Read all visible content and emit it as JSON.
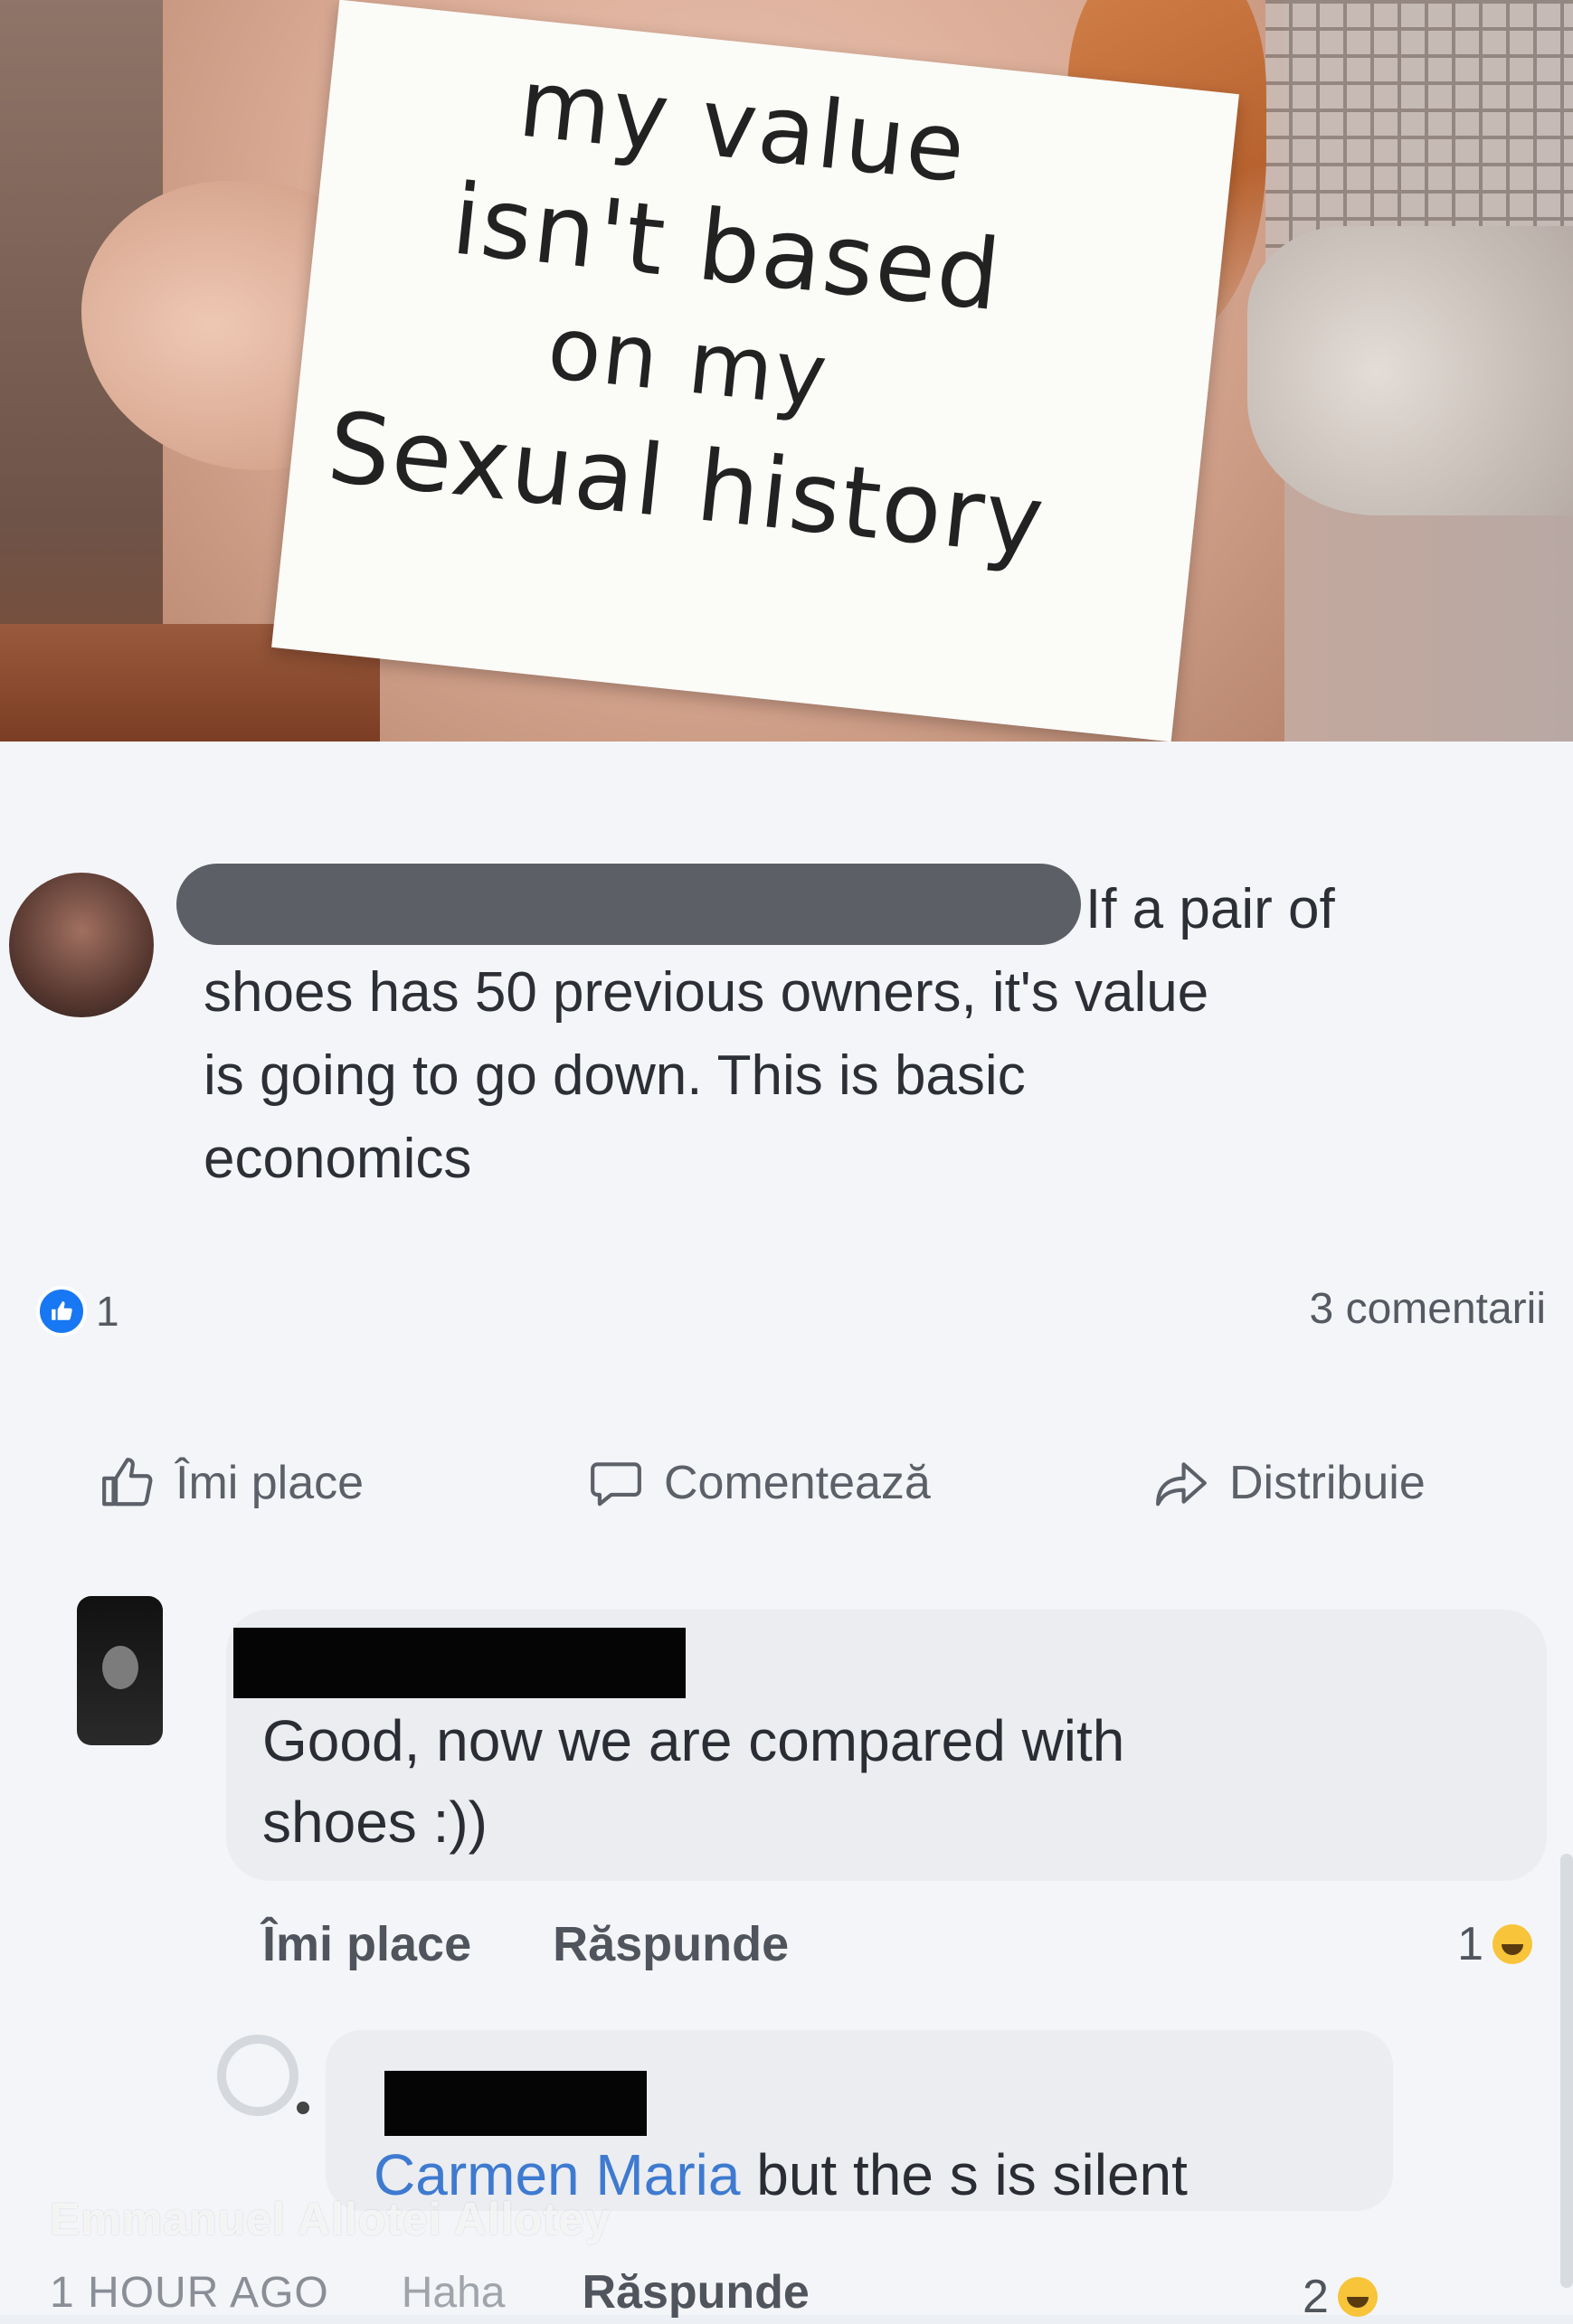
{
  "photo": {
    "sign_lines": [
      "my value",
      "isn't based",
      "on my",
      "Sexual history"
    ]
  },
  "post": {
    "text": "If a pair of shoes has 50 previous owners, it's value is going to go down. This is basic economics",
    "text_line1": "If a pair of",
    "text_line2": "shoes has 50 previous owners, it's value",
    "text_line3": "is going to go down. This is basic",
    "text_line4": "economics",
    "reaction_count": "1",
    "comments_count": "3 comentarii"
  },
  "actions": {
    "like": "Îmi place",
    "comment": "Comentează",
    "share": "Distribuie"
  },
  "comment1": {
    "text_line1": "Good, now we are compared with",
    "text_line2": "shoes :))",
    "like_label": "Îmi place",
    "reply_label": "Răspunde",
    "reaction_count": "1"
  },
  "reply1": {
    "mention": "Carmen Maria",
    "text": " but the s is silent",
    "time": "1 HOUR AGO",
    "haha_label": "Haha",
    "reply_label": "Răspunde",
    "reaction_count": "2"
  },
  "watermark": "Emmanuel Allotei Allotey",
  "colors": {
    "like_blue": "#1877f2",
    "mention_blue": "#3e7ad0",
    "haha_yellow": "#f7c43a"
  }
}
